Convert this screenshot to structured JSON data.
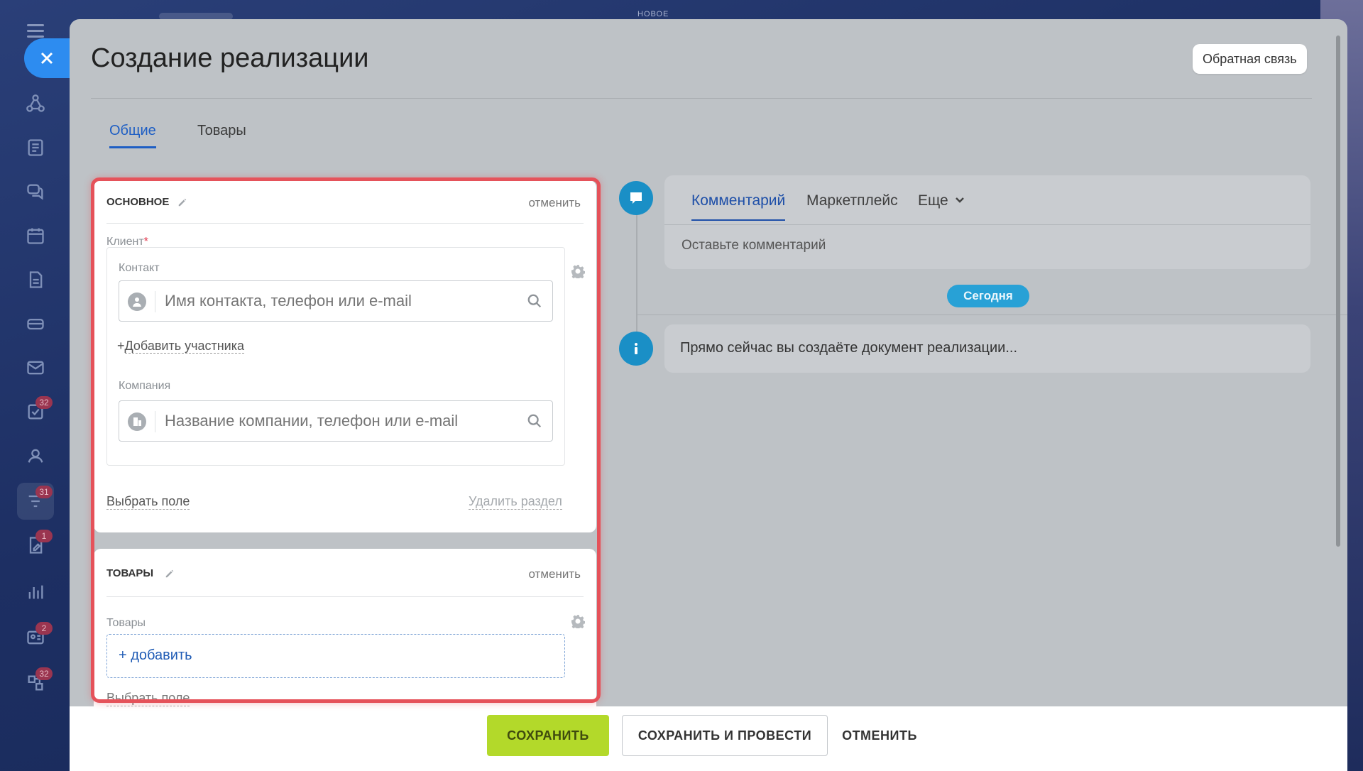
{
  "app": {
    "top_label": "НОВОЕ"
  },
  "rail": {
    "items": [
      {
        "icon": "funnel-nodes-icon",
        "badge": ""
      },
      {
        "icon": "news-feed-icon",
        "badge": ""
      },
      {
        "icon": "chat-icon",
        "badge": ""
      },
      {
        "icon": "calendar-icon",
        "badge": ""
      },
      {
        "icon": "document-icon",
        "badge": ""
      },
      {
        "icon": "drive-icon",
        "badge": ""
      },
      {
        "icon": "mail-icon",
        "badge": ""
      },
      {
        "icon": "tasks-icon",
        "badge": "32"
      },
      {
        "icon": "contacts-icon",
        "badge": ""
      },
      {
        "icon": "crm-filter-icon",
        "badge": "31"
      },
      {
        "icon": "edit-doc-icon",
        "badge": "1"
      },
      {
        "icon": "analytics-icon",
        "badge": ""
      },
      {
        "icon": "workgroups-icon",
        "badge": "2"
      },
      {
        "icon": "automation-icon",
        "badge": "32"
      }
    ]
  },
  "header": {
    "title": "Создание реализации",
    "feedback_label": "Обратная связь"
  },
  "tabs": [
    {
      "label": "Общие",
      "active": true
    },
    {
      "label": "Товары",
      "active": false
    }
  ],
  "main_section": {
    "title": "ОСНОВНОЕ",
    "cancel_label": "отменить",
    "client_label": "Клиент",
    "required_mark": "*",
    "contact_label": "Контакт",
    "contact_placeholder": "Имя контакта, телефон или e-mail",
    "add_participant_plus": "+",
    "add_participant_label": "Добавить участника",
    "company_label": "Компания",
    "company_placeholder": "Название компании, телефон или e-mail",
    "choose_field_label": "Выбрать поле",
    "delete_section_label": "Удалить раздел"
  },
  "products_section": {
    "title": "ТОВАРЫ",
    "cancel_label": "отменить",
    "products_label": "Товары",
    "add_label": "+ добавить",
    "choose_field_label": "Выбрать поле"
  },
  "timeline": {
    "comment_tabs": [
      {
        "label": "Комментарий",
        "active": true
      },
      {
        "label": "Маркетплейс",
        "active": false
      },
      {
        "label": "Еще",
        "active": false
      }
    ],
    "comment_placeholder": "Оставьте комментарий",
    "today_label": "Сегодня",
    "info_text": "Прямо сейчас вы создаёте документ реализации..."
  },
  "footer": {
    "save_label": "СОХРАНИТЬ",
    "save_post_label": "СОХРАНИТЬ И ПРОВЕСТИ",
    "cancel_label": "ОТМЕНИТЬ"
  },
  "colors": {
    "accent_blue": "#1e5ec4",
    "save_green": "#b3d92a",
    "highlight_red": "#e5525a",
    "timeline_blue": "#1a8fc6"
  }
}
